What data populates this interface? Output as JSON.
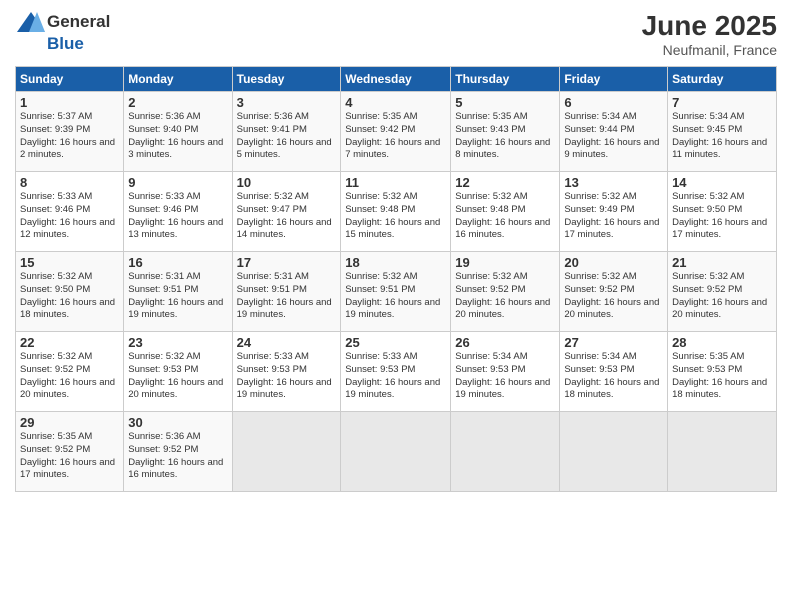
{
  "header": {
    "logo_general": "General",
    "logo_blue": "Blue",
    "month_title": "June 2025",
    "location": "Neufmanil, France"
  },
  "weekdays": [
    "Sunday",
    "Monday",
    "Tuesday",
    "Wednesday",
    "Thursday",
    "Friday",
    "Saturday"
  ],
  "weeks": [
    [
      {
        "day": "1",
        "sunrise": "Sunrise: 5:37 AM",
        "sunset": "Sunset: 9:39 PM",
        "daylight": "Daylight: 16 hours and 2 minutes."
      },
      {
        "day": "2",
        "sunrise": "Sunrise: 5:36 AM",
        "sunset": "Sunset: 9:40 PM",
        "daylight": "Daylight: 16 hours and 3 minutes."
      },
      {
        "day": "3",
        "sunrise": "Sunrise: 5:36 AM",
        "sunset": "Sunset: 9:41 PM",
        "daylight": "Daylight: 16 hours and 5 minutes."
      },
      {
        "day": "4",
        "sunrise": "Sunrise: 5:35 AM",
        "sunset": "Sunset: 9:42 PM",
        "daylight": "Daylight: 16 hours and 7 minutes."
      },
      {
        "day": "5",
        "sunrise": "Sunrise: 5:35 AM",
        "sunset": "Sunset: 9:43 PM",
        "daylight": "Daylight: 16 hours and 8 minutes."
      },
      {
        "day": "6",
        "sunrise": "Sunrise: 5:34 AM",
        "sunset": "Sunset: 9:44 PM",
        "daylight": "Daylight: 16 hours and 9 minutes."
      },
      {
        "day": "7",
        "sunrise": "Sunrise: 5:34 AM",
        "sunset": "Sunset: 9:45 PM",
        "daylight": "Daylight: 16 hours and 11 minutes."
      }
    ],
    [
      {
        "day": "8",
        "sunrise": "Sunrise: 5:33 AM",
        "sunset": "Sunset: 9:46 PM",
        "daylight": "Daylight: 16 hours and 12 minutes."
      },
      {
        "day": "9",
        "sunrise": "Sunrise: 5:33 AM",
        "sunset": "Sunset: 9:46 PM",
        "daylight": "Daylight: 16 hours and 13 minutes."
      },
      {
        "day": "10",
        "sunrise": "Sunrise: 5:32 AM",
        "sunset": "Sunset: 9:47 PM",
        "daylight": "Daylight: 16 hours and 14 minutes."
      },
      {
        "day": "11",
        "sunrise": "Sunrise: 5:32 AM",
        "sunset": "Sunset: 9:48 PM",
        "daylight": "Daylight: 16 hours and 15 minutes."
      },
      {
        "day": "12",
        "sunrise": "Sunrise: 5:32 AM",
        "sunset": "Sunset: 9:48 PM",
        "daylight": "Daylight: 16 hours and 16 minutes."
      },
      {
        "day": "13",
        "sunrise": "Sunrise: 5:32 AM",
        "sunset": "Sunset: 9:49 PM",
        "daylight": "Daylight: 16 hours and 17 minutes."
      },
      {
        "day": "14",
        "sunrise": "Sunrise: 5:32 AM",
        "sunset": "Sunset: 9:50 PM",
        "daylight": "Daylight: 16 hours and 17 minutes."
      }
    ],
    [
      {
        "day": "15",
        "sunrise": "Sunrise: 5:32 AM",
        "sunset": "Sunset: 9:50 PM",
        "daylight": "Daylight: 16 hours and 18 minutes."
      },
      {
        "day": "16",
        "sunrise": "Sunrise: 5:31 AM",
        "sunset": "Sunset: 9:51 PM",
        "daylight": "Daylight: 16 hours and 19 minutes."
      },
      {
        "day": "17",
        "sunrise": "Sunrise: 5:31 AM",
        "sunset": "Sunset: 9:51 PM",
        "daylight": "Daylight: 16 hours and 19 minutes."
      },
      {
        "day": "18",
        "sunrise": "Sunrise: 5:32 AM",
        "sunset": "Sunset: 9:51 PM",
        "daylight": "Daylight: 16 hours and 19 minutes."
      },
      {
        "day": "19",
        "sunrise": "Sunrise: 5:32 AM",
        "sunset": "Sunset: 9:52 PM",
        "daylight": "Daylight: 16 hours and 20 minutes."
      },
      {
        "day": "20",
        "sunrise": "Sunrise: 5:32 AM",
        "sunset": "Sunset: 9:52 PM",
        "daylight": "Daylight: 16 hours and 20 minutes."
      },
      {
        "day": "21",
        "sunrise": "Sunrise: 5:32 AM",
        "sunset": "Sunset: 9:52 PM",
        "daylight": "Daylight: 16 hours and 20 minutes."
      }
    ],
    [
      {
        "day": "22",
        "sunrise": "Sunrise: 5:32 AM",
        "sunset": "Sunset: 9:52 PM",
        "daylight": "Daylight: 16 hours and 20 minutes."
      },
      {
        "day": "23",
        "sunrise": "Sunrise: 5:32 AM",
        "sunset": "Sunset: 9:53 PM",
        "daylight": "Daylight: 16 hours and 20 minutes."
      },
      {
        "day": "24",
        "sunrise": "Sunrise: 5:33 AM",
        "sunset": "Sunset: 9:53 PM",
        "daylight": "Daylight: 16 hours and 19 minutes."
      },
      {
        "day": "25",
        "sunrise": "Sunrise: 5:33 AM",
        "sunset": "Sunset: 9:53 PM",
        "daylight": "Daylight: 16 hours and 19 minutes."
      },
      {
        "day": "26",
        "sunrise": "Sunrise: 5:34 AM",
        "sunset": "Sunset: 9:53 PM",
        "daylight": "Daylight: 16 hours and 19 minutes."
      },
      {
        "day": "27",
        "sunrise": "Sunrise: 5:34 AM",
        "sunset": "Sunset: 9:53 PM",
        "daylight": "Daylight: 16 hours and 18 minutes."
      },
      {
        "day": "28",
        "sunrise": "Sunrise: 5:35 AM",
        "sunset": "Sunset: 9:53 PM",
        "daylight": "Daylight: 16 hours and 18 minutes."
      }
    ],
    [
      {
        "day": "29",
        "sunrise": "Sunrise: 5:35 AM",
        "sunset": "Sunset: 9:52 PM",
        "daylight": "Daylight: 16 hours and 17 minutes."
      },
      {
        "day": "30",
        "sunrise": "Sunrise: 5:36 AM",
        "sunset": "Sunset: 9:52 PM",
        "daylight": "Daylight: 16 hours and 16 minutes."
      },
      null,
      null,
      null,
      null,
      null
    ]
  ]
}
